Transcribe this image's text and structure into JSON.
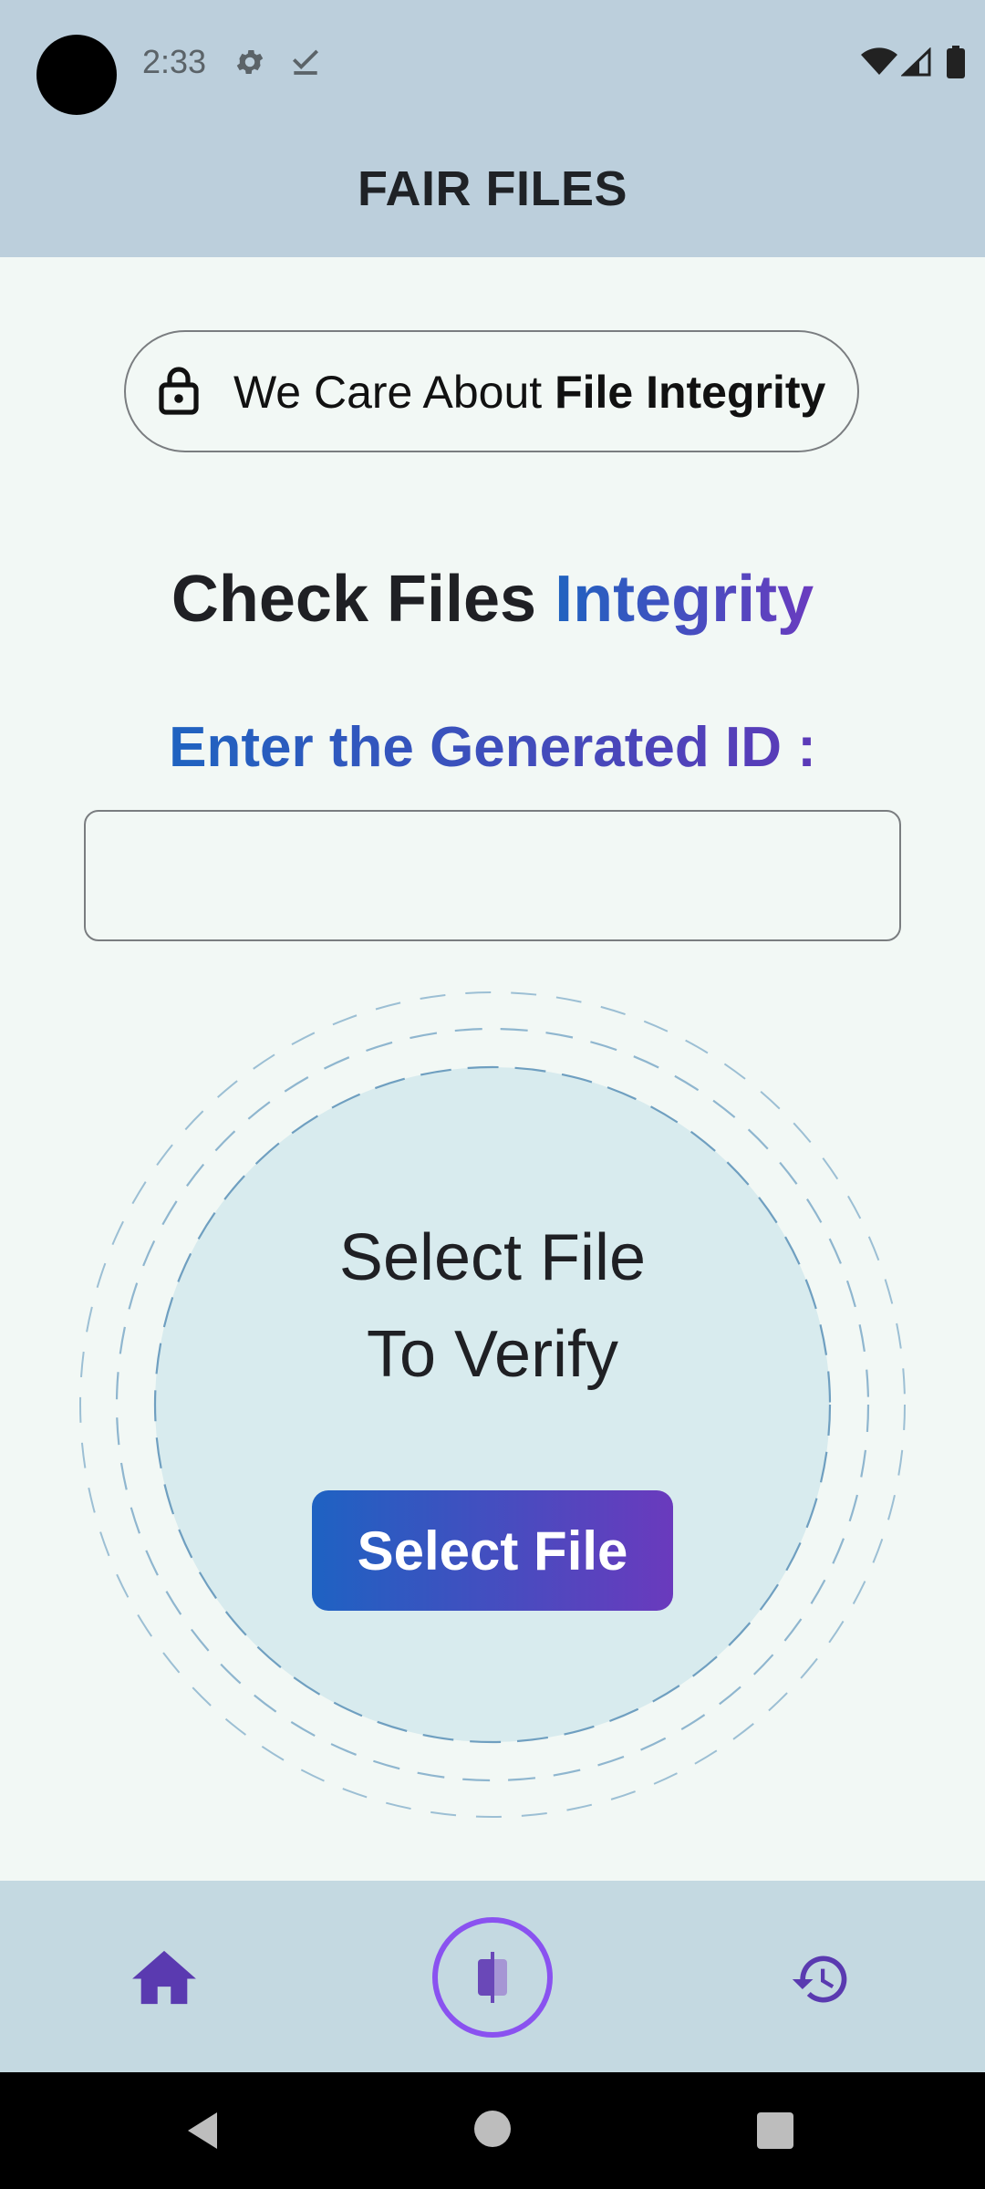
{
  "status_bar": {
    "time": "2:33",
    "icons": [
      "gear-icon",
      "check-icon",
      "wifi-icon",
      "signal-icon",
      "battery-icon"
    ]
  },
  "app_bar": {
    "title": "FAIR FILES"
  },
  "tagline": {
    "icon": "lock-icon",
    "prefix": "We Care About ",
    "emphasis": "File Integrity"
  },
  "heading": {
    "prefix": "Check Files ",
    "accent": "Integrity"
  },
  "id_field": {
    "label": "Enter the Generated ID :",
    "value": "",
    "placeholder": ""
  },
  "drop_zone": {
    "line1": "Select File",
    "line2": "To Verify",
    "button_label": "Select File"
  },
  "bottom_nav": {
    "items": [
      {
        "name": "home",
        "icon": "home-icon"
      },
      {
        "name": "compare",
        "icon": "compare-icon",
        "active": true
      },
      {
        "name": "history",
        "icon": "history-icon"
      }
    ]
  },
  "colors": {
    "accent_gradient_start": "#1e62c2",
    "accent_gradient_end": "#6a3abd",
    "app_bar_bg": "#bccfdc",
    "bottom_nav_bg": "#c4d9e1",
    "page_bg": "#f2f8f5"
  }
}
